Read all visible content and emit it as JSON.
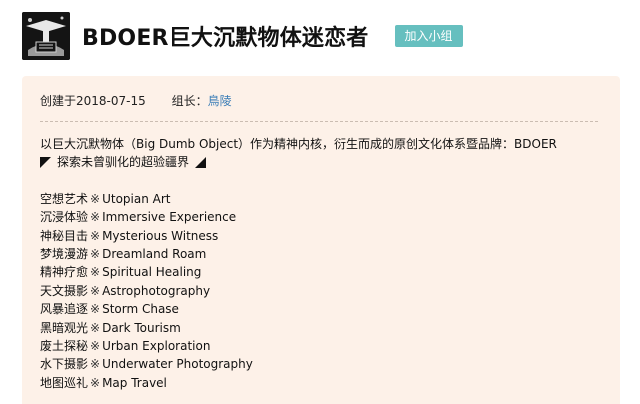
{
  "header": {
    "logo_icon": "group-avatar-logo",
    "title": "BDOER巨大沉默物体迷恋者",
    "join_button": "加入小组"
  },
  "meta": {
    "created_label": "创建于2018-07-15",
    "leader_label": "组长：",
    "leader_name": "鳥陵"
  },
  "description": {
    "intro": "以巨大沉默物体（Big Dumb Object）作为精神内核，衍生而成的原创文化体系暨品牌：BDOER",
    "tagline": "探索未曾驯化的超验疆界",
    "separator": "※",
    "items": [
      {
        "zh": "空想艺术",
        "en": "Utopian Art"
      },
      {
        "zh": "沉浸体验",
        "en": "Immersive Experience"
      },
      {
        "zh": "神秘目击",
        "en": "Mysterious Witness"
      },
      {
        "zh": "梦境漫游",
        "en": "Dreamland Roam"
      },
      {
        "zh": "精神疗愈",
        "en": "Spiritual Healing"
      },
      {
        "zh": "天文摄影",
        "en": "Astrophotography"
      },
      {
        "zh": "风暴追逐",
        "en": "Storm Chase"
      },
      {
        "zh": "黑暗观光",
        "en": "Dark Tourism"
      },
      {
        "zh": "废土探秘",
        "en": "Urban Exploration"
      },
      {
        "zh": "水下摄影",
        "en": "Underwater Photography"
      },
      {
        "zh": "地图巡礼",
        "en": "Map Travel"
      }
    ]
  },
  "colors": {
    "card_background": "#fdf1e8",
    "button": "#66bfbf",
    "link": "#3a7db6"
  }
}
